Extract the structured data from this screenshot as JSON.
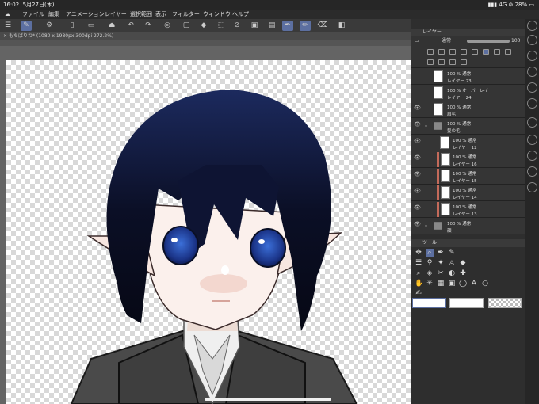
{
  "status": {
    "time": "16:02",
    "date": "5月27日(木)",
    "network": "4G",
    "battery": "28%"
  },
  "menu": [
    "ファイル",
    "編集",
    "アニメーション",
    "レイヤー",
    "選択範囲",
    "表示",
    "フィルター",
    "ウィンドウ",
    "ヘルプ"
  ],
  "document": {
    "tab": "もちばりね* (1080 x 1980px 300dpi 272.2%)"
  },
  "layer_panel": {
    "title": "レイヤー",
    "blend": "通常",
    "opacity": "100"
  },
  "layers": [
    {
      "opacity": "100 % 通常",
      "name": "レイヤー 23",
      "type": "layer",
      "visible": false
    },
    {
      "opacity": "100 % オーバーレイ",
      "name": "レイヤー 24",
      "type": "layer",
      "visible": false
    },
    {
      "opacity": "100 % 通常",
      "name": "眉毛",
      "type": "layer",
      "visible": true
    },
    {
      "opacity": "100 % 通常",
      "name": "髪の毛",
      "type": "folder",
      "visible": true
    },
    {
      "opacity": "100 % 通常",
      "name": "レイヤー 12",
      "type": "layer",
      "visible": true
    },
    {
      "opacity": "100 % 通常",
      "name": "レイヤー 16",
      "type": "clip",
      "visible": true
    },
    {
      "opacity": "100 % 通常",
      "name": "レイヤー 15",
      "type": "clip",
      "visible": true
    },
    {
      "opacity": "100 % 通常",
      "name": "レイヤー 14",
      "type": "clip",
      "visible": true
    },
    {
      "opacity": "100 % 通常",
      "name": "レイヤー 13",
      "type": "clip",
      "visible": true
    },
    {
      "opacity": "100 % 通常",
      "name": "顔",
      "type": "folder",
      "visible": true
    }
  ],
  "tool_panel": {
    "title": "ツール"
  },
  "colors": {
    "accent": "#5c6fa0",
    "hair": "#0d1330",
    "eye": "#1f3f9a",
    "clip_marker": "#c46a5a"
  }
}
